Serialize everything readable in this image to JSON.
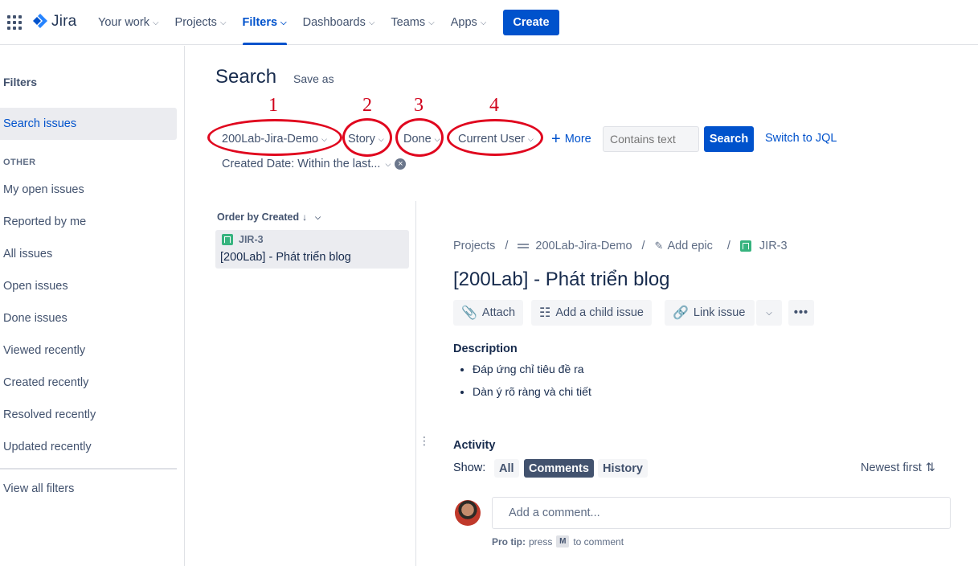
{
  "nav": {
    "logo": "Jira",
    "items": [
      {
        "label": "Your work"
      },
      {
        "label": "Projects"
      },
      {
        "label": "Filters"
      },
      {
        "label": "Dashboards"
      },
      {
        "label": "Teams"
      },
      {
        "label": "Apps"
      }
    ],
    "create_label": "Create",
    "active_item": "Filters",
    "accent_color": "#0052cc"
  },
  "sidebar": {
    "title": "Filters",
    "active_item": "Search issues",
    "section_label": "OTHER",
    "items": [
      {
        "label": "My open issues"
      },
      {
        "label": "Reported by me"
      },
      {
        "label": "All issues"
      },
      {
        "label": "Open issues"
      },
      {
        "label": "Done issues"
      },
      {
        "label": "Viewed recently"
      },
      {
        "label": "Created recently"
      },
      {
        "label": "Resolved recently"
      },
      {
        "label": "Updated recently"
      }
    ],
    "view_all": "View all filters"
  },
  "search": {
    "title": "Search",
    "save_as": "Save as",
    "annotations": [
      "1",
      "2",
      "3",
      "4"
    ],
    "annotation_color": "#e0061e",
    "filters": {
      "project": "200Lab-Jira-Demo",
      "type": "Story",
      "status": "Done",
      "assignee": "Current User"
    },
    "more_label": "More",
    "contains_placeholder": "Contains text",
    "search_button": "Search",
    "switch_jql": "Switch to JQL",
    "created_filter": "Created Date: Within the last..."
  },
  "issue_list": {
    "order_by": "Order by Created",
    "items": [
      {
        "key": "JIR-3",
        "summary": "[200Lab] - Phát triển blog"
      }
    ]
  },
  "detail": {
    "breadcrumb": {
      "projects": "Projects",
      "project": "200Lab-Jira-Demo",
      "epic": "Add epic",
      "key": "JIR-3"
    },
    "title": "[200Lab] - Phát triển blog",
    "actions": {
      "attach": "Attach",
      "child": "Add a child issue",
      "link": "Link issue"
    },
    "description_label": "Description",
    "description": [
      "Đáp ứng chỉ tiêu đề ra",
      "Dàn ý rõ ràng và chi tiết"
    ],
    "activity": {
      "label": "Activity",
      "show_label": "Show:",
      "tabs": [
        {
          "label": "All"
        },
        {
          "label": "Comments"
        },
        {
          "label": "History"
        }
      ],
      "selected_tab": "Comments",
      "sort_label": "Newest first",
      "comment_placeholder": "Add a comment...",
      "pro_tip_label": "Pro tip:",
      "pro_tip_press": "press",
      "pro_tip_key": "M",
      "pro_tip_suffix": "to comment"
    }
  }
}
